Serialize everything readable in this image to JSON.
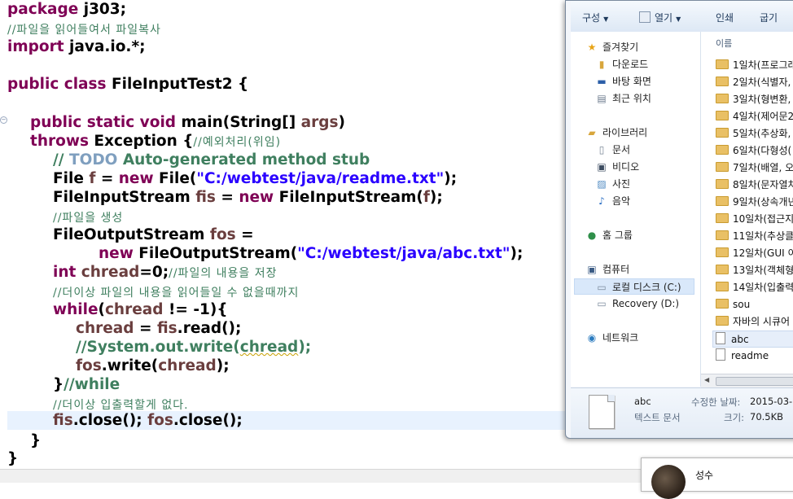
{
  "editor": {
    "lines": {
      "l1_a": "package",
      "l1_b": " j303;",
      "l2": "//파일을 읽어들여서 파일복사",
      "l3_a": "import",
      "l3_b": " java.io.*;",
      "l5_a": "public class",
      "l5_b": " FileInputTest2 {",
      "l7_a": "public static void",
      "l7_b": " main(String[] ",
      "l7_c": "args",
      "l7_d": ")",
      "l8_a": "throws",
      "l8_b": " Exception {",
      "l8_c": "//예외처리(위임)",
      "l9_a": "// ",
      "l9_b": "TODO",
      "l9_c": " Auto-generated method stub",
      "l10_a": "File ",
      "l10_b": "f",
      "l10_c": " = ",
      "l10_d": "new",
      "l10_e": " File(",
      "l10_f": "\"C:/webtest/java/readme.txt\"",
      "l10_g": ");",
      "l11_a": "FileInputStream ",
      "l11_b": "fis",
      "l11_c": " = ",
      "l11_d": "new",
      "l11_e": " FileInputStream(",
      "l11_f": "f",
      "l11_g": ");",
      "l12": "//파일을 생성",
      "l13_a": "FileOutputStream ",
      "l13_b": "fos",
      "l13_c": " =",
      "l14_a": "new",
      "l14_b": " FileOutputStream(",
      "l14_c": "\"C:/webtest/java/abc.txt\"",
      "l14_d": ");",
      "l15_a": "int",
      "l15_b": " chread",
      "l15_c": "=0;",
      "l15_d": "//파일의 내용을 저장",
      "l16": "//더이상 파일의 내용을 읽어들일 수 없을때까지",
      "l17_a": "while",
      "l17_b": "(",
      "l17_c": "chread",
      "l17_d": " != -1){",
      "l18_a": "chread",
      "l18_b": " = ",
      "l18_c": "fis",
      "l18_d": ".read();",
      "l19_a": "//System.out.write(",
      "l19_b": "chread",
      "l19_c": ");",
      "l20_a": "fos",
      "l20_b": ".write(",
      "l20_c": "chread",
      "l20_d": ");",
      "l21_a": "}",
      "l21_b": "//while",
      "l22": "//더이상 입출력할게 없다.",
      "l23_a": "fis",
      "l23_b": ".close(); ",
      "l23_c": "fos",
      "l23_d": ".close();",
      "l24": "}",
      "l25": "}"
    },
    "colors": {
      "keyword": "#7f0055",
      "string": "#2a00ff",
      "comment": "#3f7f5f",
      "todo": "#7f9fbf",
      "variable": "#6a3e3e",
      "current_line": "#e8f2fe"
    }
  },
  "explorer": {
    "toolbar": {
      "organize": "구성",
      "open": "열기",
      "print": "인쇄",
      "burn": "굽기"
    },
    "nav": {
      "favorites": "즐겨찾기",
      "downloads": "다운로드",
      "desktop": "바탕 화면",
      "recent": "최근 위치",
      "libraries": "라이브러리",
      "documents": "문서",
      "videos": "비디오",
      "pictures": "사진",
      "music": "음악",
      "homegroup": "홈 그룹",
      "computer": "컴퓨터",
      "local_disk": "로컬 디스크 (C:)",
      "recovery": "Recovery (D:)",
      "network": "네트워크"
    },
    "column_name": "이름",
    "files": [
      "1일차(프로그래",
      "2일차(식별자,",
      "3일차(형변환,",
      "4일차(제어문2",
      "5일차(추상화,",
      "6일차(다형성(",
      "7일차(배열, 오",
      "8일차(문자열처",
      "9일차(상속개년",
      "10일차(접근지",
      "11일차(추상클",
      "12일차(GUI 이",
      "13일차(객체형",
      "14일차(입출력",
      "sou",
      "자바의 시큐어",
      "abc",
      "readme"
    ],
    "details": {
      "name": "abc",
      "type": "텍스트 문서",
      "modified_label": "수정한 날짜:",
      "modified_value": "2015-03-0",
      "size_label": "크기:",
      "size_value": "70.5KB"
    }
  },
  "popup": {
    "name": "성수"
  }
}
